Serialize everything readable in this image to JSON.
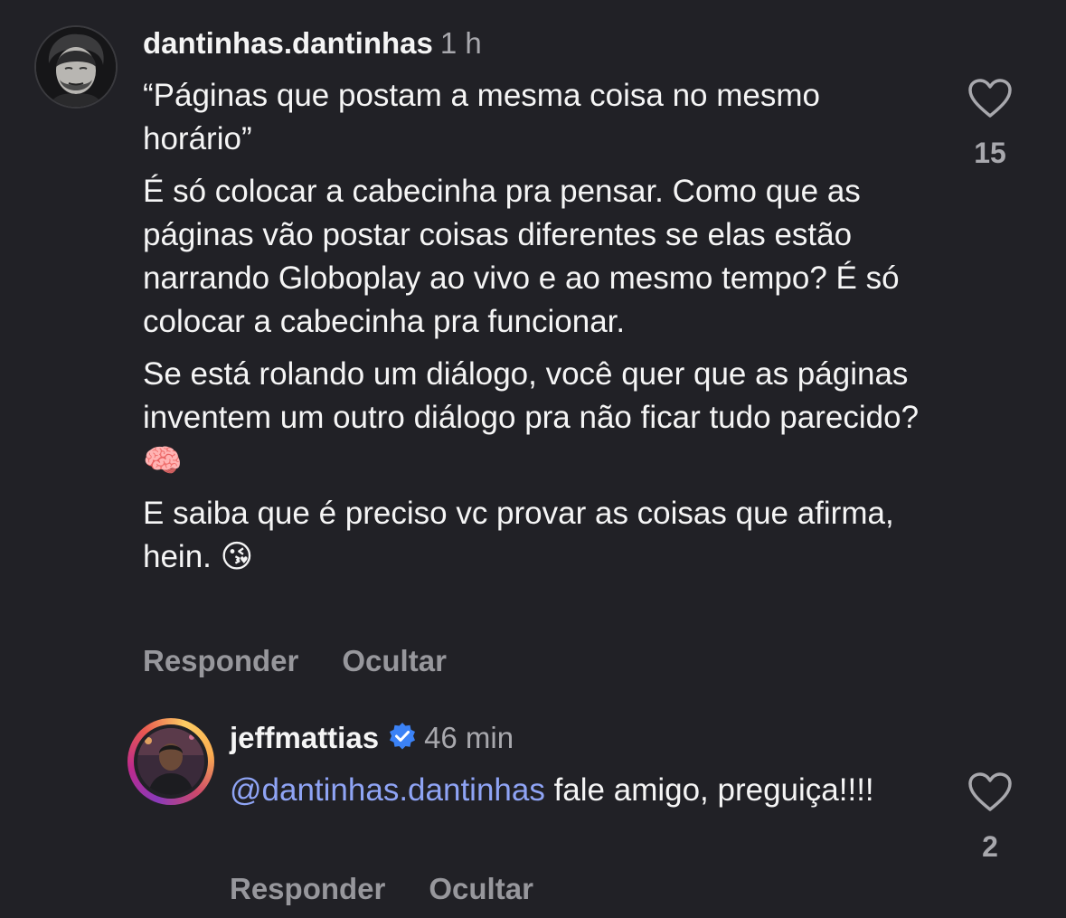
{
  "comments": [
    {
      "username": "dantinhas.dantinhas",
      "time": "1 h",
      "paragraphs": [
        "“Páginas que postam a mesma coisa no mesmo horário”",
        "É só colocar a cabecinha pra pensar. Como que as páginas vão postar coisas diferentes se elas estão narrando Globoplay ao vivo e ao mesmo tempo? É só colocar a cabecinha pra funcionar.",
        "Se está rolando um diálogo, você quer que as páginas inventem um outro diálogo pra não ficar tudo parecido? 🧠",
        "E saiba que é preciso vc provar as coisas que afirma, hein. 😘"
      ],
      "likes": "15",
      "reply_label": "Responder",
      "hide_label": "Ocultar",
      "avatar_icon": "person-avatar-icon",
      "like_icon": "heart-outline-icon"
    },
    {
      "username": "jeffmattias",
      "verified": true,
      "verified_color": "#3b82f6",
      "time": "46 min",
      "mention": "@dantinhas.dantinhas",
      "text": " fale amigo, preguiça!!!!",
      "likes": "2",
      "reply_label": "Responder",
      "hide_label": "Ocultar",
      "avatar_icon": "person-avatar-story-ring-icon",
      "like_icon": "heart-outline-icon"
    }
  ],
  "colors": {
    "background": "#212126",
    "text": "#f5f5f5",
    "secondary": "#a8a8ad",
    "mention": "#8fa4f5"
  }
}
